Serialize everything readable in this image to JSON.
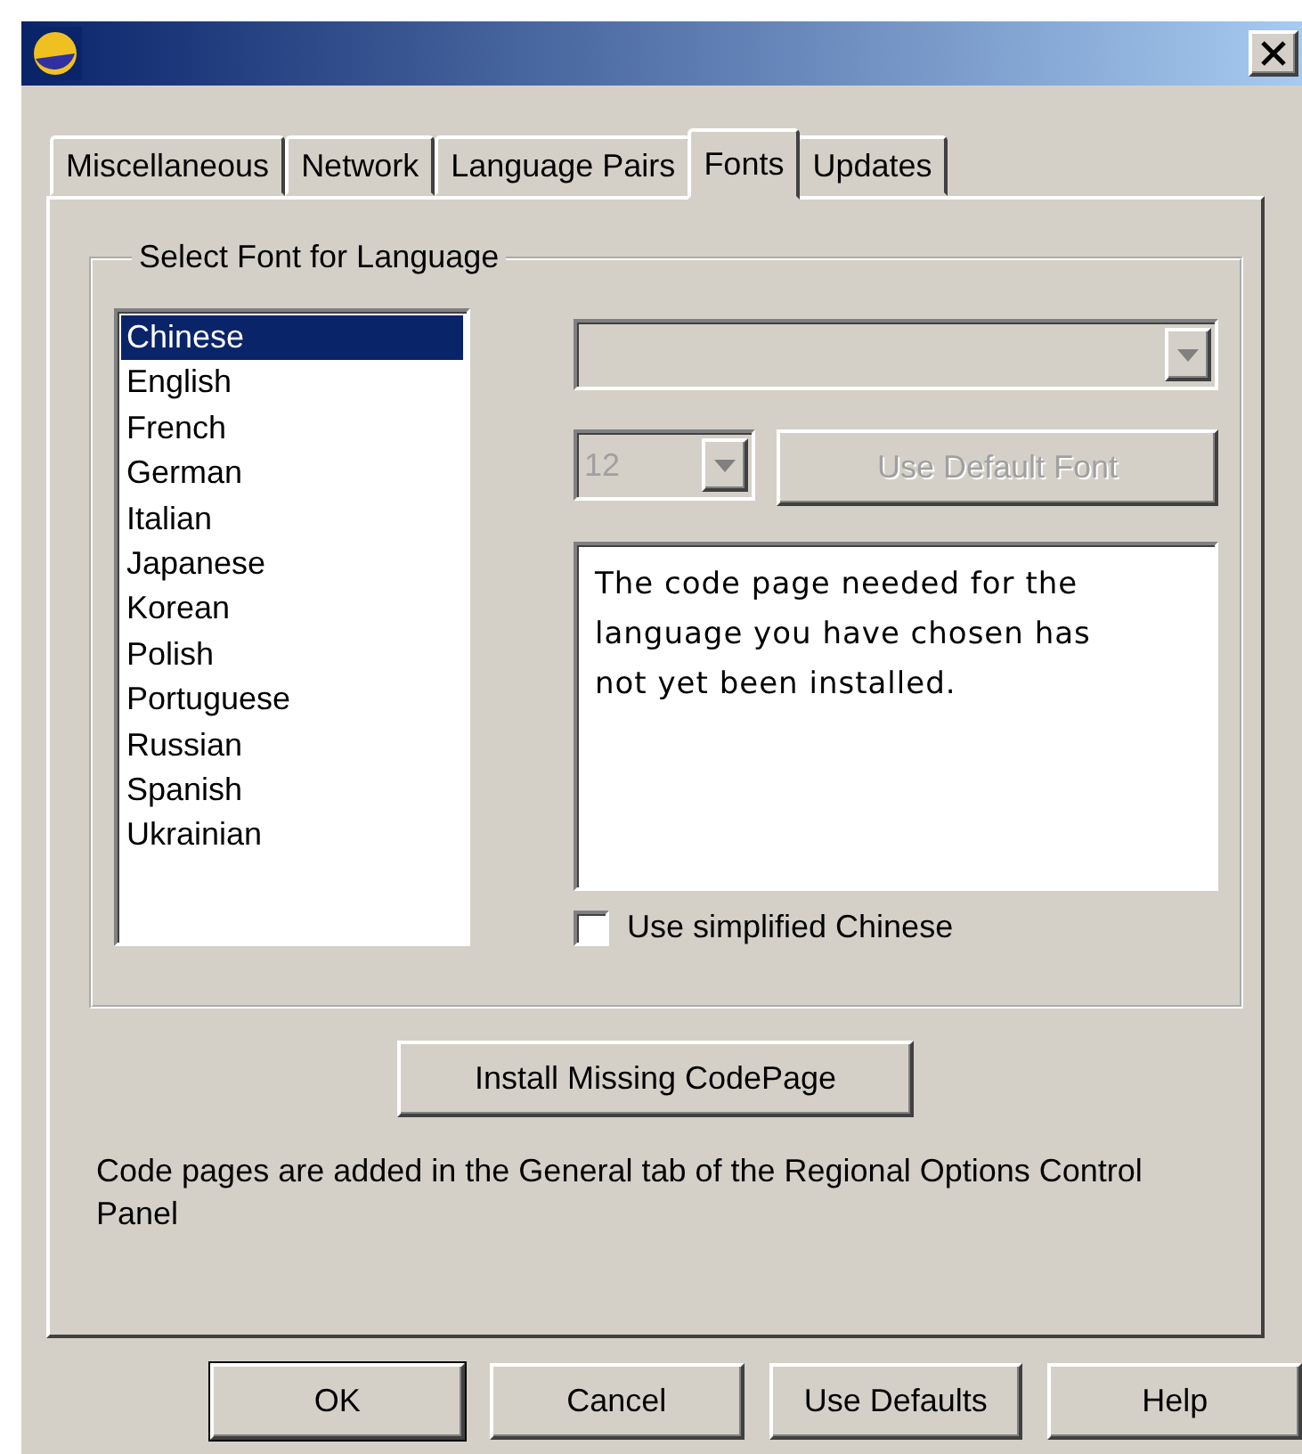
{
  "tabs": [
    {
      "label": "Miscellaneous",
      "selected": false
    },
    {
      "label": "Network",
      "selected": false
    },
    {
      "label": "Language Pairs",
      "selected": false
    },
    {
      "label": "Fonts",
      "selected": true
    },
    {
      "label": "Updates",
      "selected": false
    }
  ],
  "group": {
    "title": "Select Font for Language",
    "languages": [
      {
        "label": "Chinese",
        "selected": true
      },
      {
        "label": "English",
        "selected": false
      },
      {
        "label": "French",
        "selected": false
      },
      {
        "label": "German",
        "selected": false
      },
      {
        "label": "Italian",
        "selected": false
      },
      {
        "label": "Japanese",
        "selected": false
      },
      {
        "label": "Korean",
        "selected": false
      },
      {
        "label": "Polish",
        "selected": false
      },
      {
        "label": "Portuguese",
        "selected": false
      },
      {
        "label": "Russian",
        "selected": false
      },
      {
        "label": "Spanish",
        "selected": false
      },
      {
        "label": "Ukrainian",
        "selected": false
      }
    ],
    "font_dropdown": {
      "disabled": true
    },
    "size_dropdown": {
      "value": "12",
      "disabled": true
    },
    "default_font_button": {
      "label": "Use Default Font",
      "disabled": true
    },
    "message": "The code page needed for the language you have chosen has not yet been installed.",
    "simplified_checkbox": {
      "label": "Use simplified Chinese",
      "checked": false
    }
  },
  "install_button": {
    "label": "Install Missing CodePage"
  },
  "note": "Code pages are added in the General tab of the Regional Options Control Panel",
  "buttons": [
    {
      "label": "OK",
      "default": true
    },
    {
      "label": "Cancel",
      "default": false
    },
    {
      "label": "Use Defaults",
      "default": false
    },
    {
      "label": "Help",
      "default": false
    }
  ]
}
